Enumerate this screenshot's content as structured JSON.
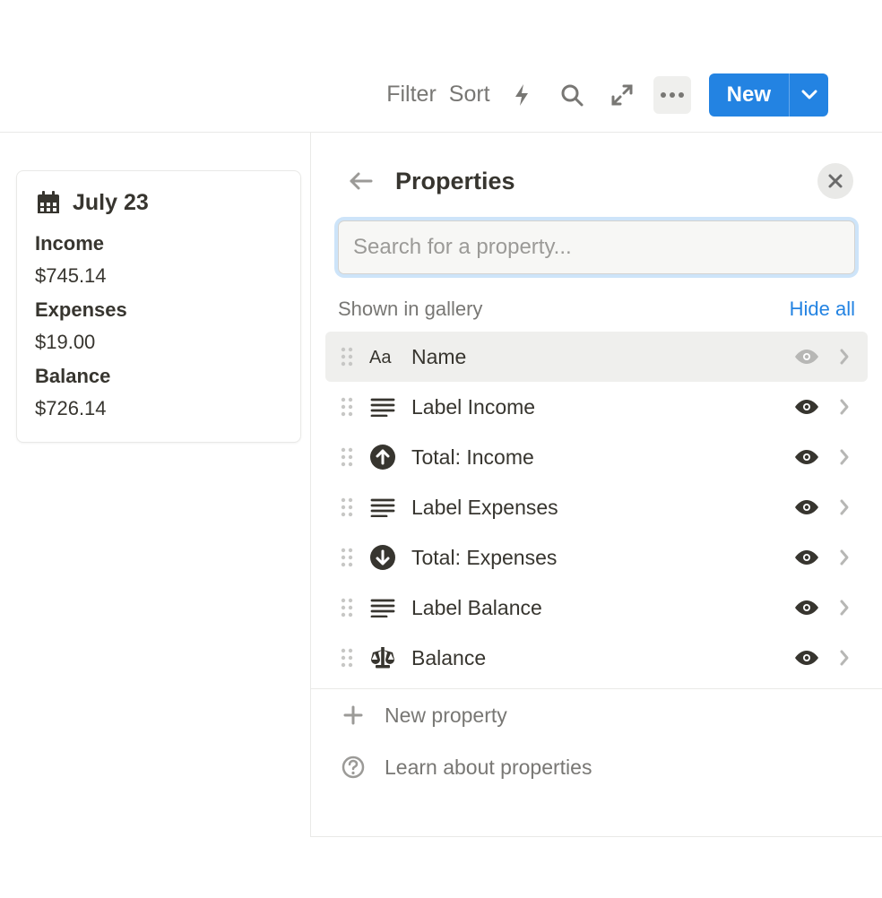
{
  "toolbar": {
    "filter": "Filter",
    "sort": "Sort",
    "new": "New"
  },
  "card": {
    "title": "July 23",
    "items": [
      {
        "label": "Income",
        "value": "$745.14"
      },
      {
        "label": "Expenses",
        "value": "$19.00"
      },
      {
        "label": "Balance",
        "value": "$726.14"
      }
    ]
  },
  "panel": {
    "title": "Properties",
    "search_placeholder": "Search for a property...",
    "section_label": "Shown in gallery",
    "hide_all": "Hide all",
    "properties": [
      {
        "label": "Name",
        "icon": "aa",
        "eye_muted": true,
        "highlighted": true
      },
      {
        "label": "Label Income",
        "icon": "lines",
        "eye_muted": false,
        "highlighted": false
      },
      {
        "label": "Total: Income",
        "icon": "up",
        "eye_muted": false,
        "highlighted": false
      },
      {
        "label": "Label Expenses",
        "icon": "lines",
        "eye_muted": false,
        "highlighted": false
      },
      {
        "label": "Total: Expenses",
        "icon": "down",
        "eye_muted": false,
        "highlighted": false
      },
      {
        "label": "Label Balance",
        "icon": "lines",
        "eye_muted": false,
        "highlighted": false
      },
      {
        "label": "Balance",
        "icon": "scale",
        "eye_muted": false,
        "highlighted": false
      }
    ],
    "new_property": "New property",
    "learn": "Learn about properties"
  }
}
